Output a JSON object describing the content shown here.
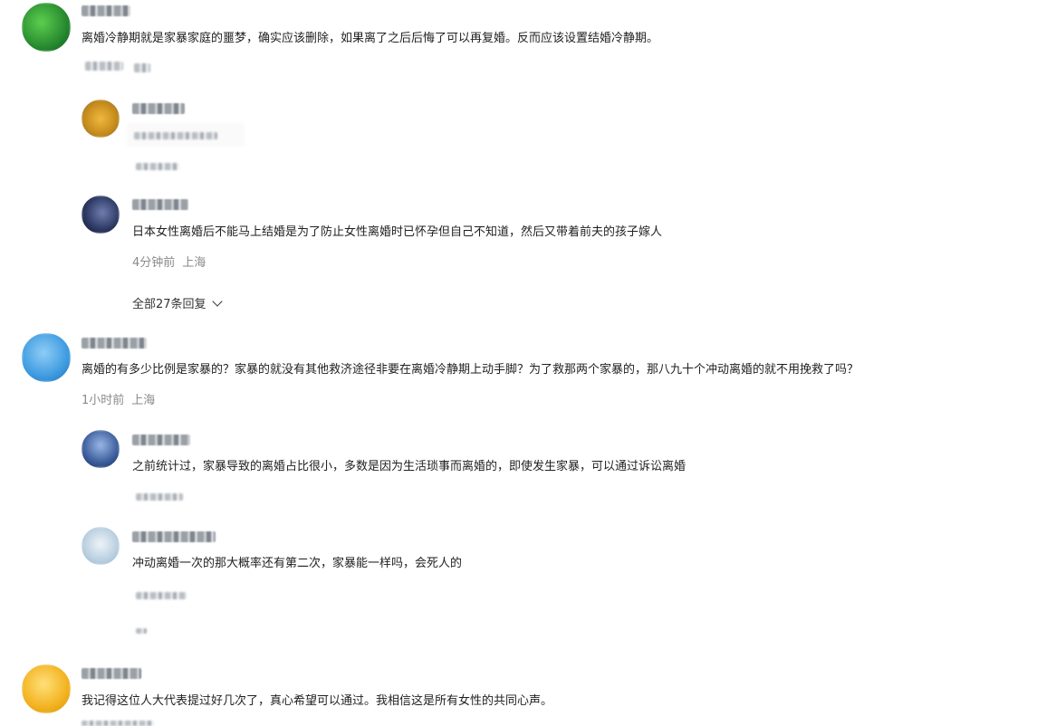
{
  "comments": [
    {
      "text": "离婚冷静期就是家暴家庭的噩梦，确实应该删除，如果离了之后后悔了可以再复婚。反而应该设置结婚冷静期。",
      "avatar_color": "#2e9e3a"
    },
    {
      "text": "离婚的有多少比例是家暴的？家暴的就没有其他救济途径非要在离婚冷静期上动手脚？为了救那两个家暴的，那八九十个冲动离婚的就不用挽救了吗？",
      "time": "1小时前",
      "location": "上海",
      "avatar_color": "#3e9be0"
    },
    {
      "text": "我记得这位人大代表提过好几次了，真心希望可以通过。我相信这是所有女性的共同心声。",
      "avatar_color": "#f2b21f"
    }
  ],
  "replies": [
    {
      "avatar_color": "#d9a21f"
    },
    {
      "text": "日本女性离婚后不能马上结婚是为了防止女性离婚时已怀孕但自己不知道，然后又带着前夫的孩子嫁人",
      "time": "4分钟前",
      "location": "上海",
      "avatar_color": "#2a3560"
    },
    {
      "text": "之前统计过，家暴导致的离婚占比很小，多数是因为生活琐事而离婚的，即使发生家暴，可以通过诉讼离婚",
      "avatar_color": "#3a5c9a"
    },
    {
      "text": "冲动离婚一次的那大概率还有第二次，家暴能一样吗，会死人的",
      "avatar_color": "#b9cfe0"
    }
  ],
  "more_replies_label": "全部27条回复",
  "icons": {
    "expand": "chevron-down-icon"
  }
}
